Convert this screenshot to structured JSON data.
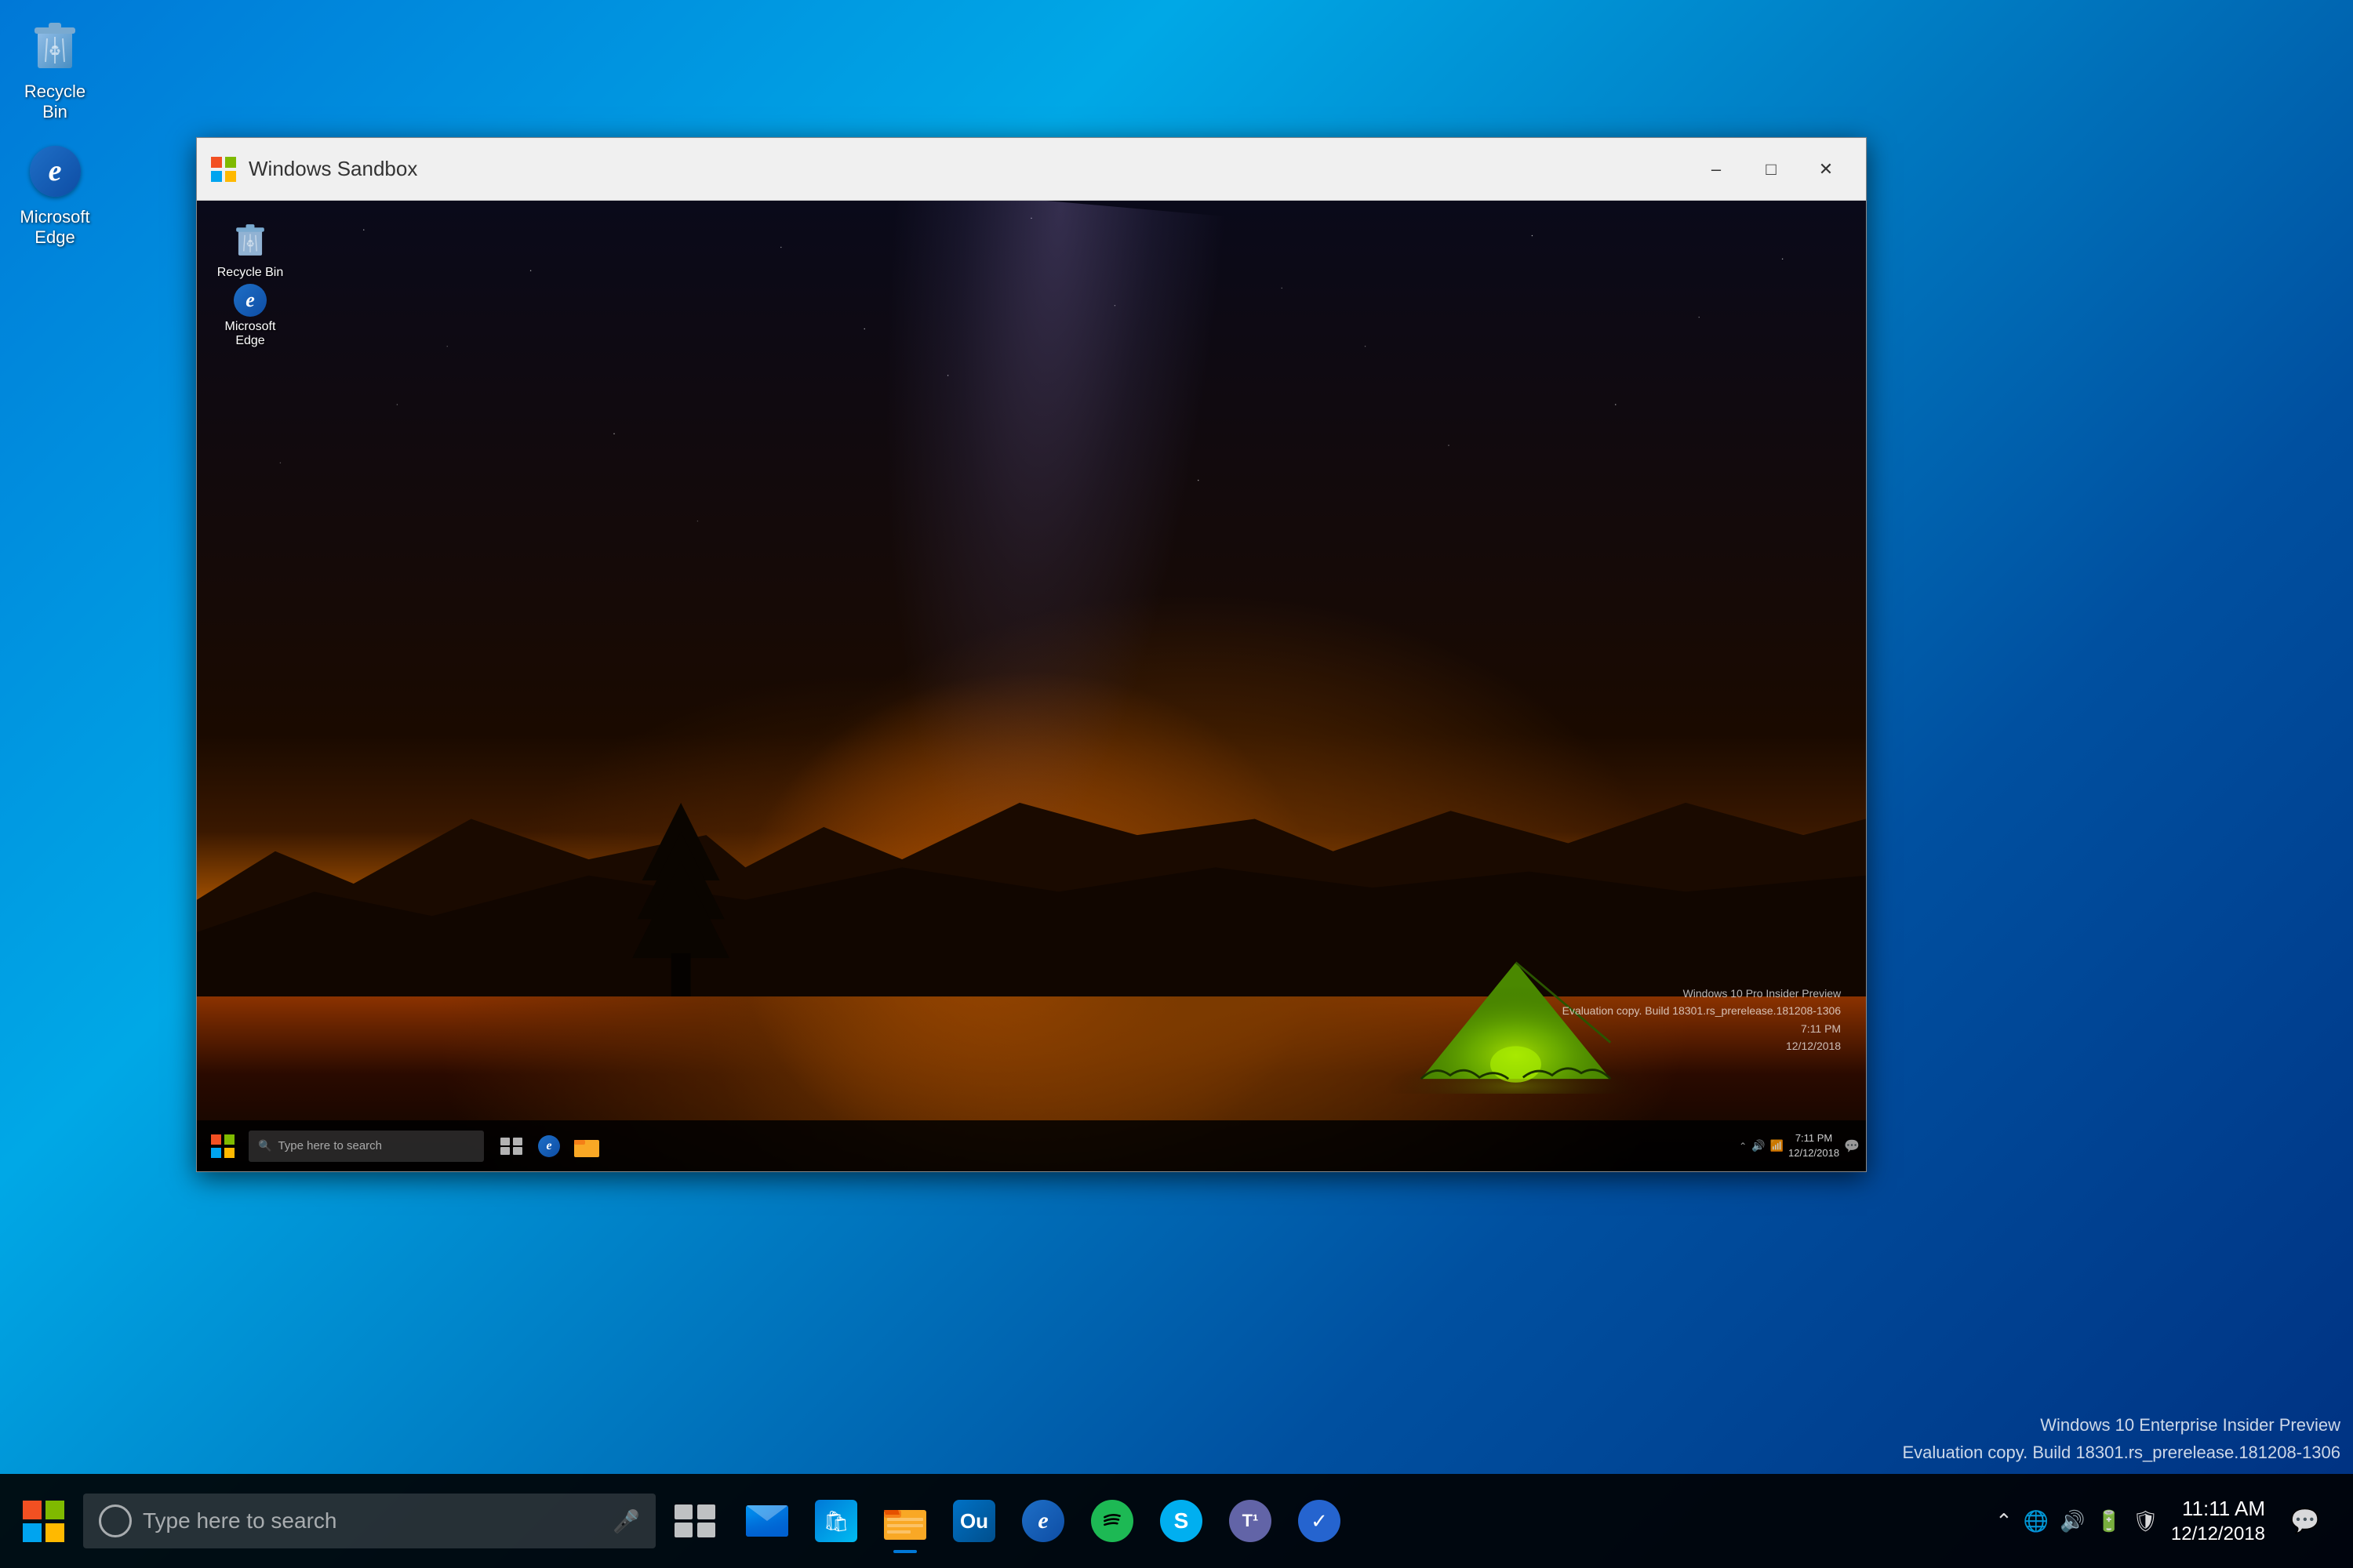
{
  "desktop": {
    "recycle_bin_label": "Recycle Bin",
    "edge_label": "Microsoft Edge"
  },
  "sandbox_window": {
    "title": "Windows Sandbox",
    "inner": {
      "recycle_bin_label": "Recycle Bin",
      "edge_label": "Microsoft Edge",
      "taskbar": {
        "search_placeholder": "Type here to search",
        "clock_time": "7:11 PM",
        "clock_date": "12/12/2018"
      },
      "build_info_line1": "Windows 10 Pro Insider Preview",
      "build_info_line2": "Evaluation copy. Build 18301.rs_prerelease.181208-1306",
      "build_info_line3": "7:11 PM",
      "build_info_line4": "12/12/2018"
    }
  },
  "taskbar": {
    "search_placeholder": "Type here to search",
    "clock_time": "11:11 AM",
    "clock_date": "12/12/2018"
  },
  "outer_build_info": {
    "line1": "Windows 10 Enterprise Insider Preview",
    "line2": "Evaluation copy. Build 18301.rs_prerelease.181208-1306"
  }
}
